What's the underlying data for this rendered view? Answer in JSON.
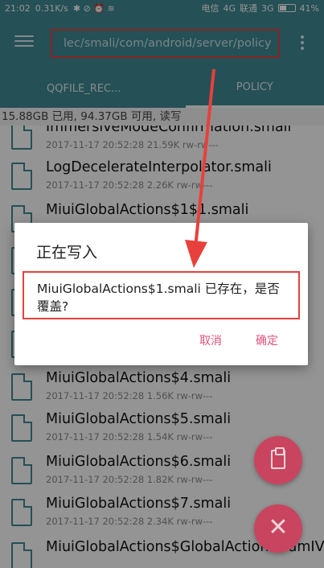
{
  "status_bar": {
    "time": "21:02",
    "speed": "0.31K/s",
    "left_icons": "✱ ⊘ ⏰ ≋",
    "carrier1": "电信",
    "network1": "4G",
    "carrier2": "联通",
    "network2": "3G",
    "battery": "41%"
  },
  "toolbar": {
    "path": "lec/smali/com/android/server/policy"
  },
  "tabs": [
    {
      "label": "QQFILE_REC..."
    },
    {
      "label": "POLICY"
    }
  ],
  "storage_info": "15.88GB 已用, 94.37GB 可用, 读写",
  "files": [
    {
      "name": "ImmersiveModeConfirmation.smali",
      "date": "2017-11-17 20:52:28",
      "size": "21.59K",
      "perm": "rw-rw---"
    },
    {
      "name": "LogDecelerateInterpolator.smali",
      "date": "2017-11-17 20:52:28",
      "size": "2.26K",
      "perm": "rw-rw---"
    },
    {
      "name": "MiuiGlobalActions$1$1.smali",
      "date": "",
      "size": "",
      "perm": ""
    },
    {
      "name": "MiuiGlobalActions$4.smali",
      "date": "2017-11-17 20:52:28",
      "size": "1.56K",
      "perm": "rw-rw---"
    },
    {
      "name": "MiuiGlobalActions$5.smali",
      "date": "2017-11-17 20:52:28",
      "size": "1.54K",
      "perm": "rw-rw---"
    },
    {
      "name": "MiuiGlobalActions$6.smali",
      "date": "2017-11-17 20:52:28",
      "size": "1.82K",
      "perm": "rw-rw---"
    },
    {
      "name": "MiuiGlobalActions$7.smali",
      "date": "2017-11-17 20:52:28",
      "size": "2.34K",
      "perm": "rw-rw---"
    },
    {
      "name": "MiuiGlobalActions$GlobalActionsMamIV",
      "date": "",
      "size": "",
      "perm": ""
    }
  ],
  "dialog": {
    "title": "正在写入",
    "message": "MiuiGlobalActions$1.smali 已存在，是否覆盖?",
    "cancel": "取消",
    "ok": "确定"
  },
  "fabs": {
    "clipboard_icon": "clipboard-icon",
    "close_icon": "close-icon",
    "close_glyph": "✕"
  },
  "colors": {
    "primary": "#3f8a95",
    "accent": "#e0517c",
    "fab": "#c9455f",
    "annotation": "#e8403c"
  }
}
